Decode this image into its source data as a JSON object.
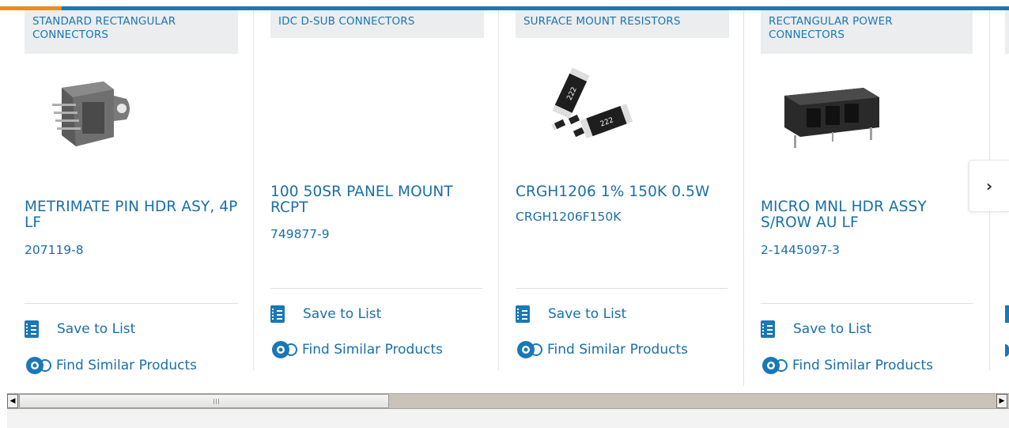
{
  "colors": {
    "brand_blue": "#1978b5",
    "accent_orange": "#f08a1c",
    "category_bg": "#ebedef"
  },
  "products": [
    {
      "category": "STANDARD RECTANGULAR CONNECTORS",
      "title": "METRIMATE PIN HDR ASY, 4P LF",
      "part_number": "207119-8",
      "save_label": "Save to List",
      "similar_label": "Find Similar Products",
      "image": "rectangular-connector-image"
    },
    {
      "category": "IDC D-SUB CONNECTORS",
      "title": "100 50SR PANEL MOUNT RCPT",
      "part_number": "749877-9",
      "save_label": "Save to List",
      "similar_label": "Find Similar Products",
      "image": ""
    },
    {
      "category": "SURFACE MOUNT RESISTORS",
      "title": "CRGH1206 1% 150K 0.5W",
      "part_number": "CRGH1206F150K",
      "save_label": "Save to List",
      "similar_label": "Find Similar Products",
      "image": "smd-resistor-image",
      "resistor_marking": "222"
    },
    {
      "category": "RECTANGULAR POWER CONNECTORS",
      "title": "MICRO MNL HDR ASSY S/ROW AU LF",
      "part_number": "2-1445097-3",
      "save_label": "Save to List",
      "similar_label": "Find Similar Products",
      "image": "power-connector-image"
    }
  ],
  "carousel": {
    "next_icon": "chevron-right-icon",
    "next_glyph": "›"
  },
  "scrollbar": {
    "left_arrow": "◀",
    "right_arrow": "▶"
  }
}
